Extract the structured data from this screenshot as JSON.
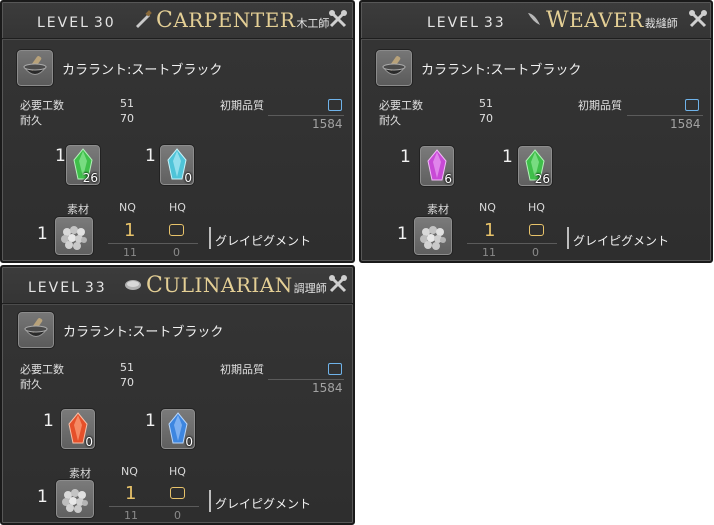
{
  "panels": [
    {
      "level_label": "LEVEL",
      "level_num": "30",
      "job_icon": "saw-icon",
      "job_initial": "C",
      "job_rest": "ARPENTER",
      "job_jp": "木工師",
      "item_name": "カララント:スートブラック",
      "stats": {
        "progress_label": "必要工数",
        "progress_value": "51",
        "durability_label": "耐久",
        "durability_value": "70"
      },
      "hq": {
        "label": "初期品質",
        "max": "1584"
      },
      "crystals": [
        {
          "qty": "1",
          "have": "26",
          "type": "wind-shard",
          "color": "#3fbf4a"
        },
        {
          "qty": "1",
          "have": "0",
          "type": "ice-shard",
          "color": "#4fc4d8"
        }
      ],
      "mats_header": {
        "mat": "素材",
        "nq": "NQ",
        "hq": "HQ"
      },
      "material": {
        "qty": "1",
        "nq": "1",
        "have_nq": "11",
        "have_hq": "0",
        "name": "グレイピグメント"
      }
    },
    {
      "level_label": "LEVEL",
      "level_num": "33",
      "job_icon": "needle-icon",
      "job_initial": "W",
      "job_rest": "EAVER",
      "job_jp": "裁縫師",
      "item_name": "カララント:スートブラック",
      "stats": {
        "progress_label": "必要工数",
        "progress_value": "51",
        "durability_label": "耐久",
        "durability_value": "70"
      },
      "hq": {
        "label": "初期品質",
        "max": "1584"
      },
      "crystals": [
        {
          "qty": "1",
          "have": "6",
          "type": "lightning-shard",
          "color": "#c84ad6"
        },
        {
          "qty": "1",
          "have": "26",
          "type": "wind-shard",
          "color": "#3fbf4a"
        }
      ],
      "mats_header": {
        "mat": "素材",
        "nq": "NQ",
        "hq": "HQ"
      },
      "material": {
        "qty": "1",
        "nq": "1",
        "have_nq": "11",
        "have_hq": "0",
        "name": "グレイピグメント"
      }
    },
    {
      "level_label": "LEVEL",
      "level_num": "33",
      "job_icon": "frying-pan-icon",
      "job_initial": "C",
      "job_rest": "ULINARIAN",
      "job_jp": "調理師",
      "item_name": "カララント:スートブラック",
      "stats": {
        "progress_label": "必要工数",
        "progress_value": "51",
        "durability_label": "耐久",
        "durability_value": "70"
      },
      "hq": {
        "label": "初期品質",
        "max": "1584"
      },
      "crystals": [
        {
          "qty": "1",
          "have": "0",
          "type": "fire-shard",
          "color": "#e5502a"
        },
        {
          "qty": "1",
          "have": "0",
          "type": "water-shard",
          "color": "#3d86e0"
        }
      ],
      "mats_header": {
        "mat": "素材",
        "nq": "NQ",
        "hq": "HQ"
      },
      "material": {
        "qty": "1",
        "nq": "1",
        "have_nq": "11",
        "have_hq": "0",
        "name": "グレイピグメント"
      }
    }
  ]
}
